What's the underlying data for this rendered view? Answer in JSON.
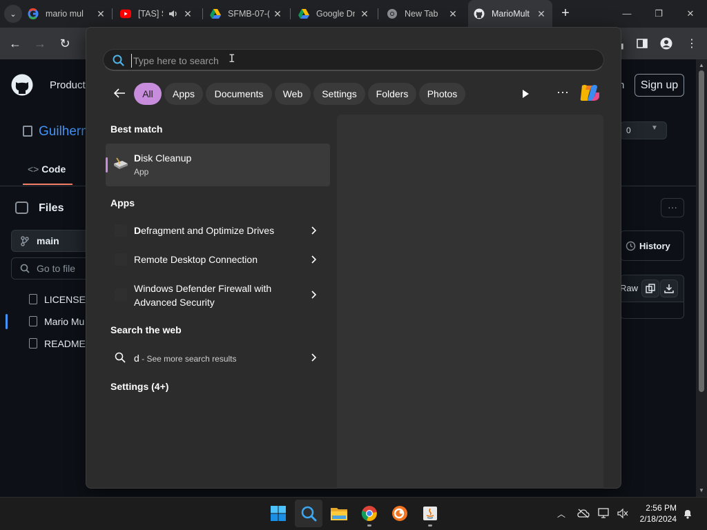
{
  "browser": {
    "tabs": [
      {
        "title": "mario mul",
        "icon": "google-icon"
      },
      {
        "title": "[TAS] S",
        "icon": "youtube-icon",
        "audio": true
      },
      {
        "title": "SFMB-07-(",
        "icon": "google-drive-icon"
      },
      {
        "title": "Google Dr",
        "icon": "google-drive-icon"
      },
      {
        "title": "New Tab",
        "icon": "chrome-icon"
      },
      {
        "title": "MarioMult",
        "icon": "github-icon",
        "active": true
      }
    ]
  },
  "github": {
    "nav_product": "Product",
    "nav_signin_tail": "n",
    "signup": "Sign up",
    "repo_owner": "Guilherm",
    "star_count": "0",
    "code_tab": "Code",
    "files_title": "Files",
    "branch": "main",
    "goto_placeholder": "Go to file",
    "files": [
      "LICENSE",
      "Mario Mu",
      "README.r"
    ],
    "history": "History",
    "raw": "Raw"
  },
  "search": {
    "placeholder": "Type here to search",
    "filters": [
      "All",
      "Apps",
      "Documents",
      "Web",
      "Settings",
      "Folders",
      "Photos"
    ],
    "active_filter": "All",
    "best_match_heading": "Best match",
    "best_match": {
      "name": "Disk Cleanup",
      "type": "App"
    },
    "apps_heading": "Apps",
    "apps": [
      {
        "line1": "Defragment and Optimize Drives",
        "line2": ""
      },
      {
        "line1": "Remote Desktop Connection",
        "line2": ""
      },
      {
        "line1": "Windows Defender Firewall with",
        "line2": "Advanced Security"
      }
    ],
    "web_heading": "Search the web",
    "web_query": "d",
    "web_suffix": " - See more search results",
    "settings_heading": "Settings (4+)",
    "accent_color": "#c88cdd"
  },
  "taskbar": {
    "apps": [
      "windows-start-icon",
      "search-icon",
      "file-explorer-icon",
      "chrome-icon",
      "crunchyroll-icon",
      "java-icon"
    ],
    "time": "2:56 PM",
    "date": "2/18/2024"
  }
}
